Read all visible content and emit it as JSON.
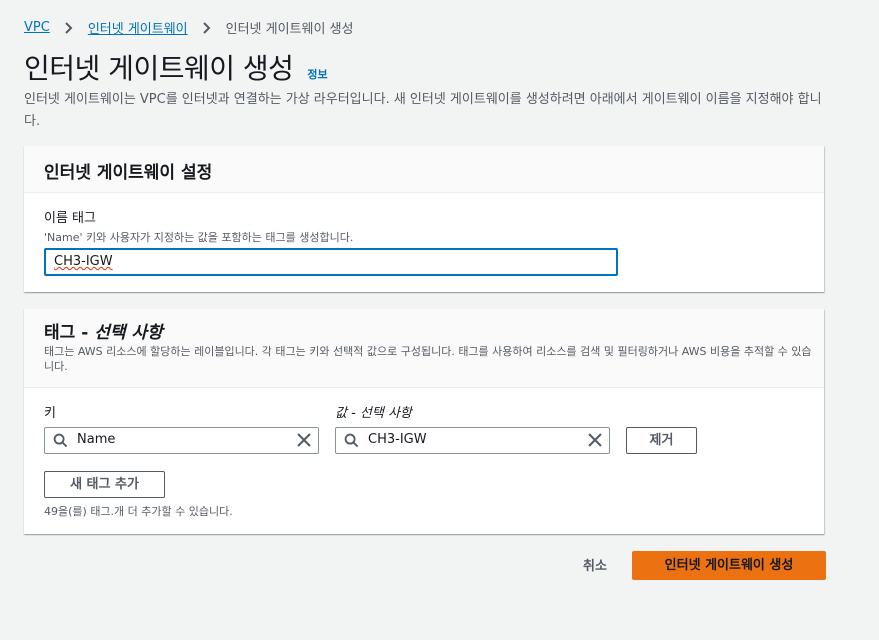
{
  "breadcrumb": {
    "item1": "VPC",
    "item2": "인터넷 게이트웨이",
    "current": "인터넷 게이트웨이 생성"
  },
  "page": {
    "title": "인터넷 게이트웨이 생성",
    "info_link": "정보",
    "description": "인터넷 게이트웨이는 VPC를 인터넷과 연결하는 가상 라우터입니다. 새 인터넷 게이트웨이를 생성하려면 아래에서 게이트웨이 이름을 지정해야 합니다."
  },
  "settings_panel": {
    "heading": "인터넷 게이트웨이 설정",
    "name_tag_label": "이름 태그",
    "name_tag_help": "'Name' 키와 사용자가 지정하는 값을 포함하는 태그를 생성합니다.",
    "name_tag_value": "CH3-IGW"
  },
  "tags_panel": {
    "heading_prefix": "태그 - ",
    "heading_optional": "선택 사항",
    "description": "태그는 AWS 리소스에 할당하는 레이블입니다. 각 태그는 키와 선택적 값으로 구성됩니다. 태그를 사용하여 리소스를 검색 및 필터링하거나 AWS 비용을 추적할 수 있습니다.",
    "key_label": "키",
    "value_label": "값 - 선택 사항",
    "key_value": "Name",
    "value_value": "CH3-IGW",
    "remove_label": "제거",
    "add_tag_label": "새 태그 추가",
    "remaining_note": "49을(를) 태그.개 더 추가할 수 있습니다."
  },
  "footer": {
    "cancel_label": "취소",
    "create_label": "인터넷 게이트웨이 생성"
  },
  "colors": {
    "link": "#0073bb",
    "primary": "#ec7211",
    "background": "#f2f3f3"
  }
}
